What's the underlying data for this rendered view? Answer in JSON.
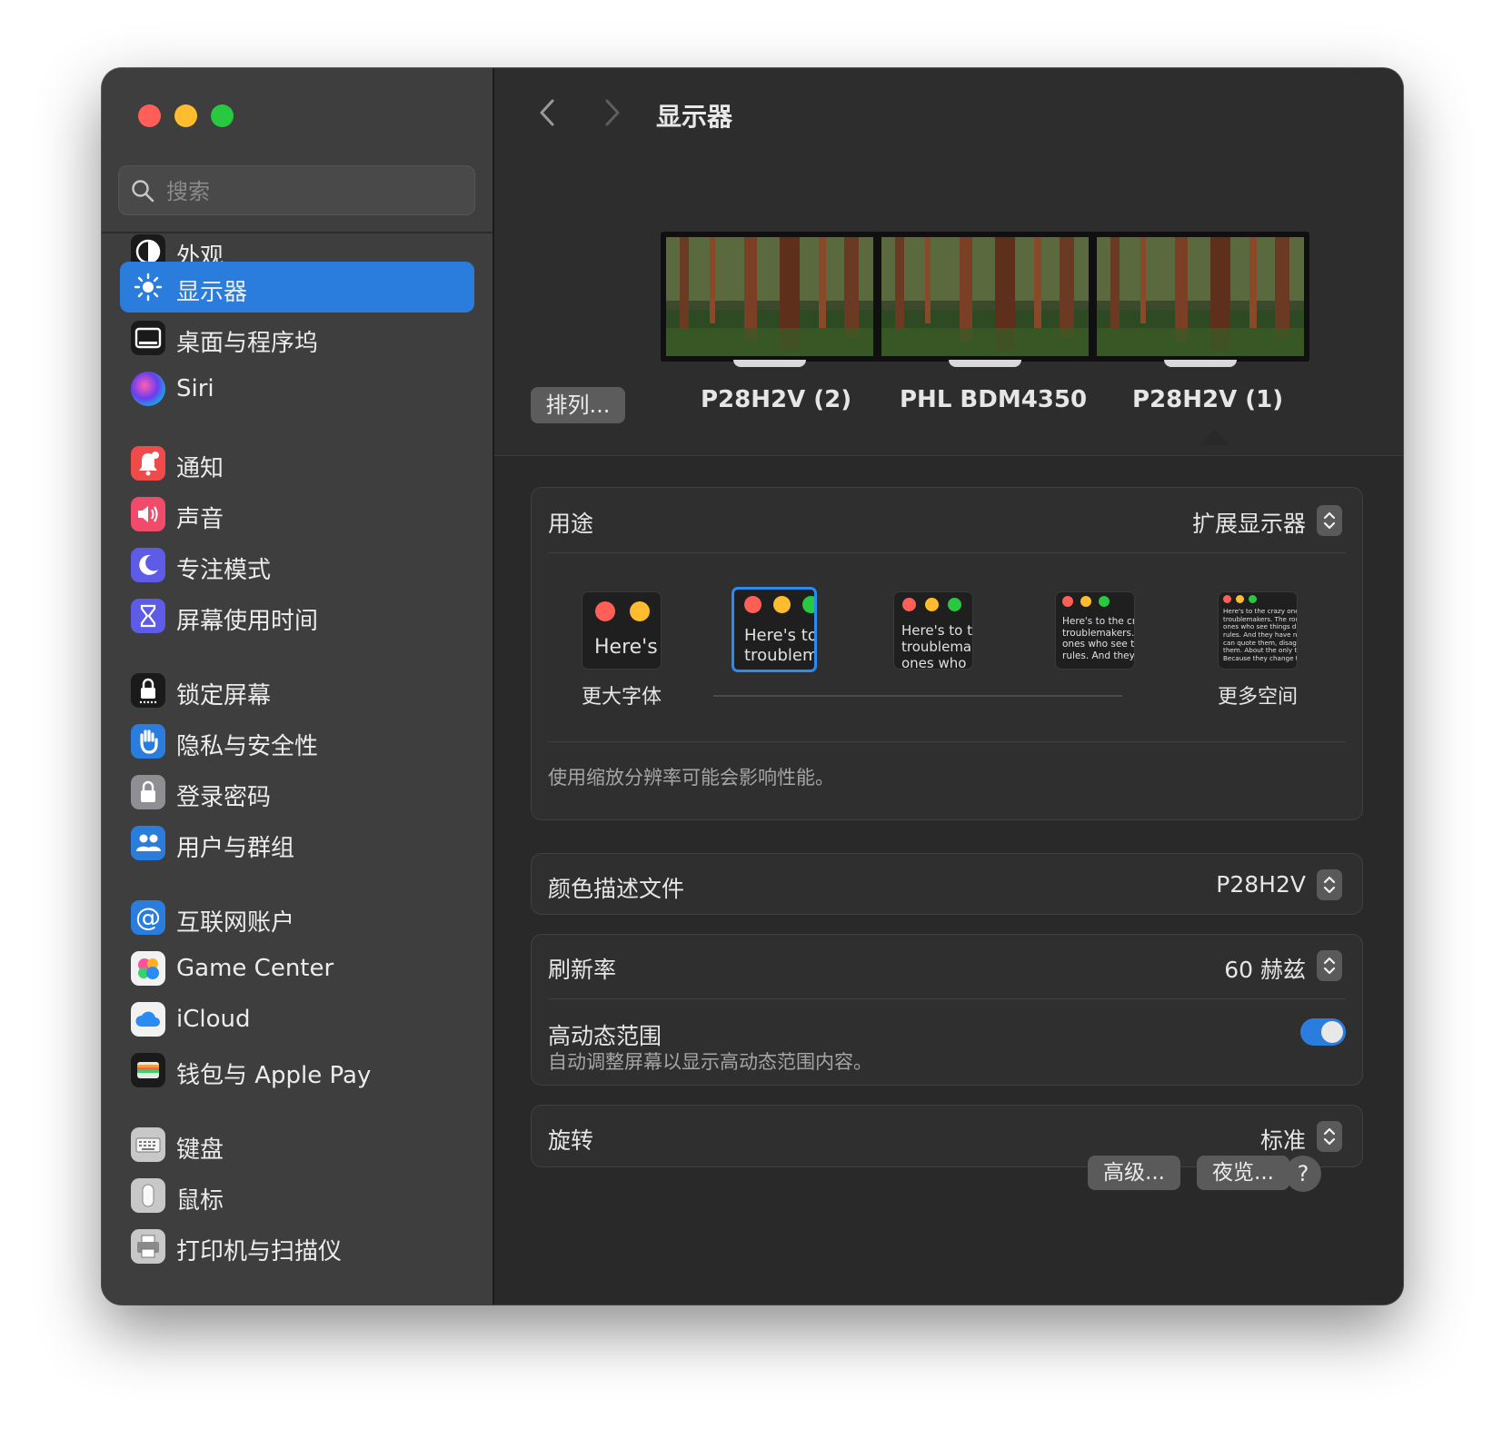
{
  "search": {
    "placeholder": "搜索"
  },
  "page": {
    "title": "显示器"
  },
  "sidebar": {
    "items": [
      {
        "label": "外观"
      },
      {
        "label": "显示器"
      },
      {
        "label": "桌面与程序坞"
      },
      {
        "label": "Siri"
      },
      {
        "label": "通知"
      },
      {
        "label": "声音"
      },
      {
        "label": "专注模式"
      },
      {
        "label": "屏幕使用时间"
      },
      {
        "label": "锁定屏幕"
      },
      {
        "label": "隐私与安全性"
      },
      {
        "label": "登录密码"
      },
      {
        "label": "用户与群组"
      },
      {
        "label": "互联网账户"
      },
      {
        "label": "Game Center"
      },
      {
        "label": "iCloud"
      },
      {
        "label": "钱包与 Apple Pay"
      },
      {
        "label": "键盘"
      },
      {
        "label": "鼠标"
      },
      {
        "label": "打印机与扫描仪"
      }
    ],
    "active_index": 1
  },
  "displays": {
    "arrange_label": "排列...",
    "monitors": [
      {
        "name": "P28H2V (2)"
      },
      {
        "name": "PHL BDM4350"
      },
      {
        "name": "P28H2V (1)"
      }
    ],
    "selected_index": 2
  },
  "usage": {
    "label": "用途",
    "value": "扩展显示器",
    "scale_left": "更大字体",
    "scale_right": "更多空间",
    "selected_scale": 1,
    "previews": [
      {
        "text": "Here's"
      },
      {
        "text": "Here's to\ntroublem"
      },
      {
        "text": "Here's to t\ntroublema\nones who"
      },
      {
        "text": "Here's to the cr\ntroublemakers.\nones who see t\nrules. And they"
      },
      {
        "text": "Here's to the crazy one\ntroublemakers. The rou\nones who see things dif\nrules. And they have no\ncan quote them, disagre\nthem. About the only th\nBecause they change th"
      }
    ],
    "note": "使用缩放分辨率可能会影响性能。"
  },
  "color_profile": {
    "label": "颜色描述文件",
    "value": "P28H2V"
  },
  "refresh_rate": {
    "label": "刷新率",
    "value": "60 赫兹"
  },
  "hdr": {
    "label": "高动态范围",
    "description": "自动调整屏幕以显示高动态范围内容。",
    "enabled": true
  },
  "rotation": {
    "label": "旋转",
    "value": "标准"
  },
  "buttons": {
    "advanced": "高级...",
    "night_shift": "夜览...",
    "help": "?"
  },
  "colors": {
    "accent": "#2a7ddd",
    "close": "#ff5f57",
    "minimize": "#febc2e",
    "maximize": "#28c840"
  }
}
